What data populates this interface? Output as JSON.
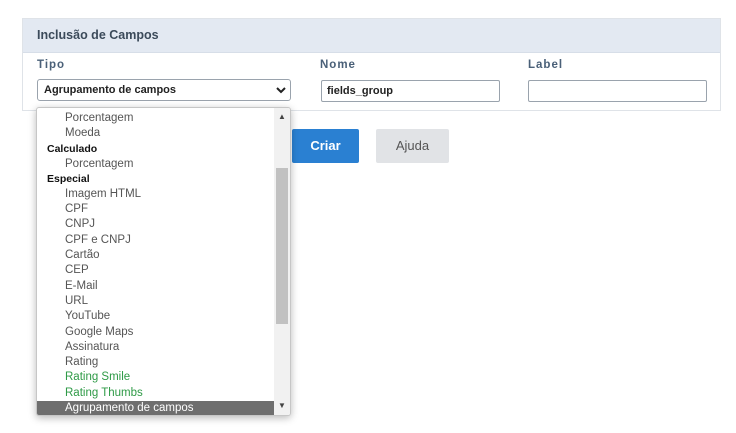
{
  "panel": {
    "title": "Inclusão de Campos"
  },
  "fields": {
    "tipo_label": "Tipo",
    "nome_label": "Nome",
    "label_label": "Label",
    "tipo_selected": "Agrupamento de campos",
    "nome_value": "fields_group",
    "label_value": ""
  },
  "buttons": {
    "criar": "Criar",
    "ajuda": "Ajuda"
  },
  "dropdown": {
    "items": [
      {
        "text": "Porcentagem",
        "kind": "option"
      },
      {
        "text": "Moeda",
        "kind": "option"
      },
      {
        "text": "Calculado",
        "kind": "group"
      },
      {
        "text": "Porcentagem",
        "kind": "option"
      },
      {
        "text": "Especial",
        "kind": "group"
      },
      {
        "text": "Imagem HTML",
        "kind": "option"
      },
      {
        "text": "CPF",
        "kind": "option"
      },
      {
        "text": "CNPJ",
        "kind": "option"
      },
      {
        "text": "CPF e CNPJ",
        "kind": "option"
      },
      {
        "text": "Cartão",
        "kind": "option"
      },
      {
        "text": "CEP",
        "kind": "option"
      },
      {
        "text": "E-Mail",
        "kind": "option"
      },
      {
        "text": "URL",
        "kind": "option"
      },
      {
        "text": "YouTube",
        "kind": "option"
      },
      {
        "text": "Google Maps",
        "kind": "option"
      },
      {
        "text": "Assinatura",
        "kind": "option"
      },
      {
        "text": "Rating",
        "kind": "option"
      },
      {
        "text": "Rating Smile",
        "kind": "option-green"
      },
      {
        "text": "Rating Thumbs",
        "kind": "option-green"
      },
      {
        "text": "Agrupamento de campos",
        "kind": "option-selected"
      }
    ]
  },
  "colors": {
    "primary": "#2a80d2",
    "header_bg": "#e3e9f2",
    "green_option": "#2e9a46",
    "selected_bg": "#6e6e6e"
  },
  "icons": {
    "select_arrow": "chevron-down-icon",
    "scroll_up": "scroll-up-arrow-icon",
    "scroll_down": "scroll-down-arrow-icon"
  }
}
